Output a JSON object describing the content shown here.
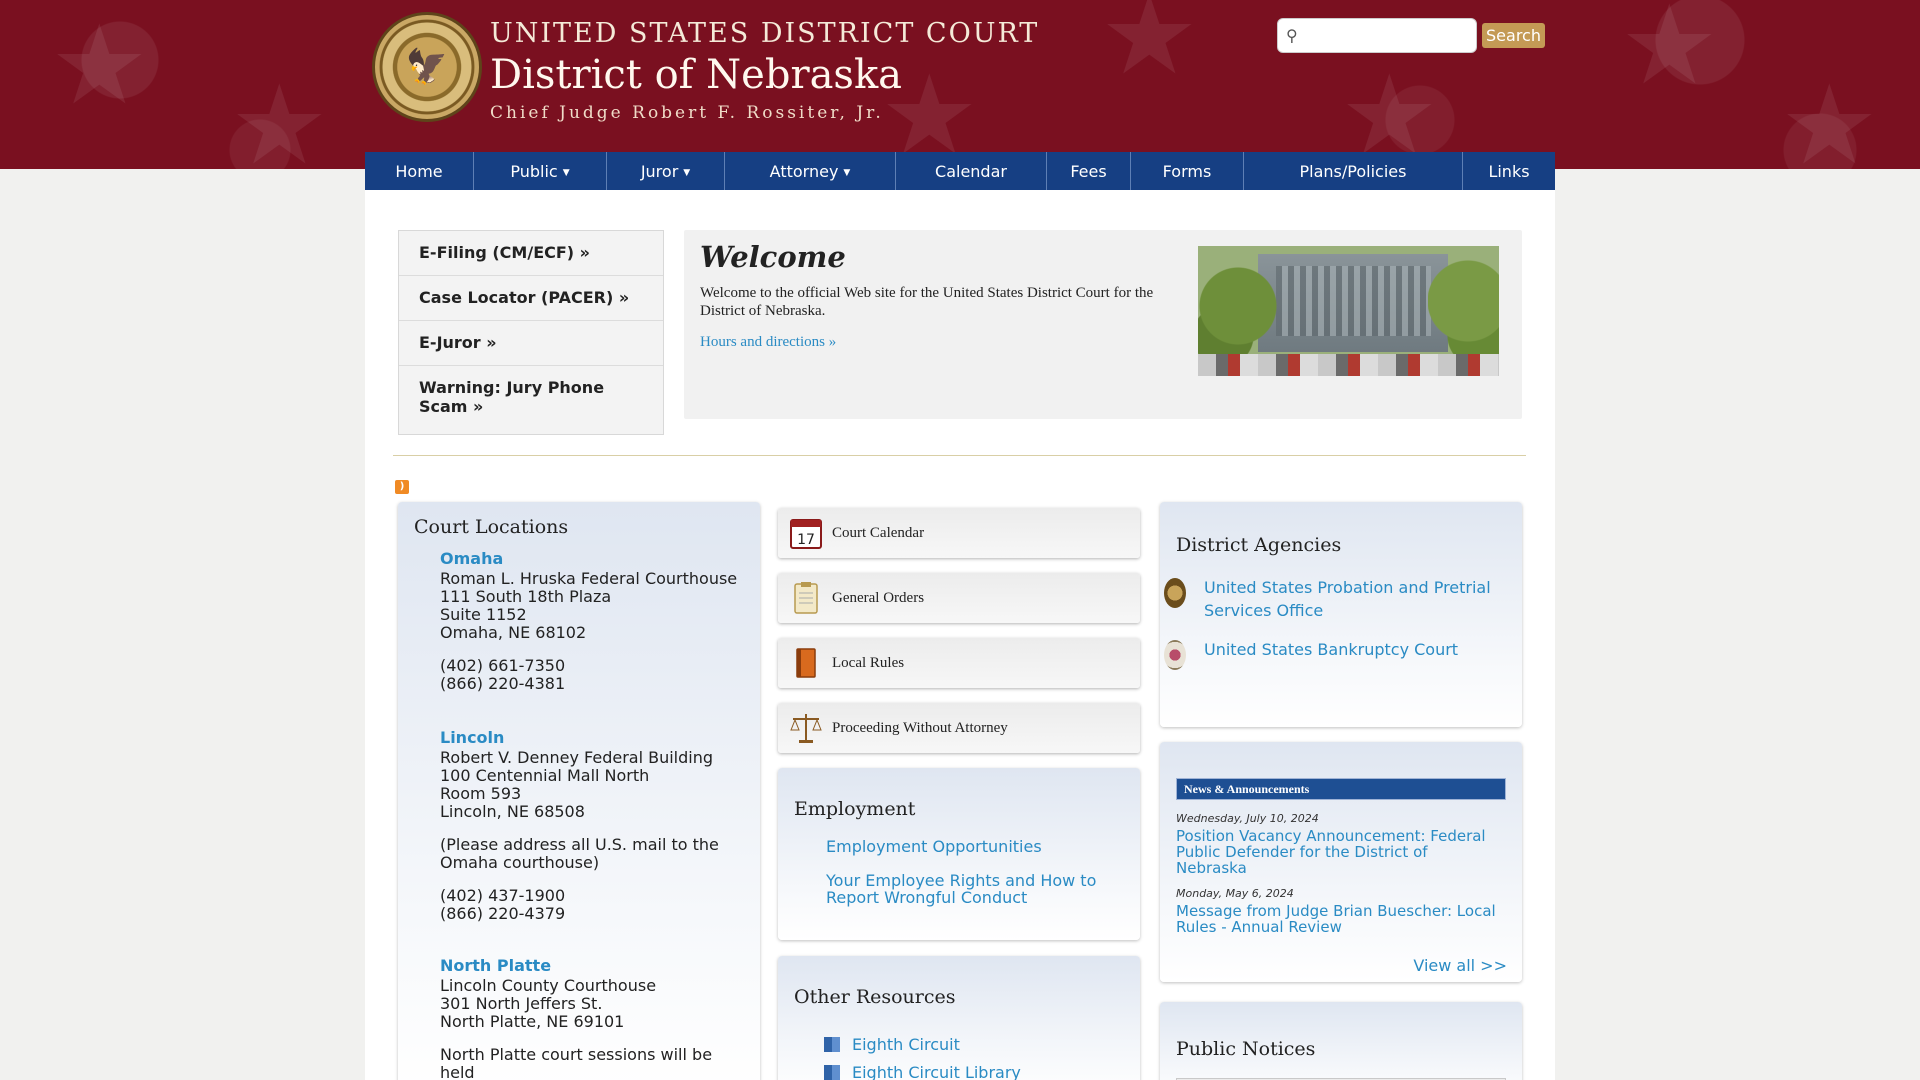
{
  "header": {
    "court_line1": "UNITED STATES DISTRICT COURT",
    "court_line2": "District of Nebraska",
    "court_line3": "Chief Judge Robert F. Rossiter, Jr.",
    "search_button": "Search",
    "search_placeholder": ""
  },
  "nav": {
    "items": [
      {
        "label": "Home"
      },
      {
        "label": "Public"
      },
      {
        "label": "Juror"
      },
      {
        "label": "Attorney"
      },
      {
        "label": "Calendar"
      },
      {
        "label": "Fees"
      },
      {
        "label": "Forms"
      },
      {
        "label": "Plans/Policies"
      },
      {
        "label": "Links"
      }
    ]
  },
  "quick_links": [
    "E-Filing (CM/ECF) »",
    "Case Locator (PACER) »",
    "E-Juror »",
    "Warning: Jury Phone Scam »"
  ],
  "welcome": {
    "title": "Welcome",
    "text": "Welcome to the official Web site for the United States District Court for the District of Nebraska.",
    "link": "Hours and directions »"
  },
  "locations": {
    "title": "Court Locations",
    "omaha": {
      "name": "Omaha",
      "line1": "Roman L. Hruska Federal Courthouse",
      "line2": "111 South 18th Plaza",
      "line3": "Suite 1152",
      "line4": "Omaha, NE  68102",
      "phone1": "(402) 661-7350",
      "phone2": "(866) 220-4381"
    },
    "lincoln": {
      "name": "Lincoln",
      "line1": "Robert V. Denney Federal Building",
      "line2": "100 Centennial Mall North",
      "line3": "Room 593",
      "line4": "Lincoln, NE  68508",
      "note": "(Please address all U.S. mail to the Omaha courthouse)",
      "phone1": "(402) 437-1900",
      "phone2": "(866) 220-4379"
    },
    "north_platte": {
      "name": "North Platte",
      "line1": "Lincoln County Courthouse",
      "line2": "301 North Jeffers St.",
      "line3": "North Platte, NE 69101",
      "note": "North Platte court sessions will be held"
    }
  },
  "resource_buttons": [
    {
      "label": "Court Calendar",
      "icon": "calendar-icon",
      "day": "17"
    },
    {
      "label": "General Orders",
      "icon": "clipboard-icon"
    },
    {
      "label": "Local Rules",
      "icon": "book-icon"
    },
    {
      "label": "Proceeding Without Attorney",
      "icon": "scales-icon"
    }
  ],
  "employment": {
    "title": "Employment",
    "link1": "Employment Opportunities",
    "link2": "Your Employee Rights and How to Report Wrongful Conduct"
  },
  "other_resources": {
    "title": "Other Resources",
    "link1": "Eighth Circuit",
    "link2": "Eighth Circuit Library"
  },
  "agencies": {
    "title": "District Agencies",
    "item1": "United States Probation and Pretrial Services Office",
    "item2": "United States Bankruptcy Court"
  },
  "news": {
    "bar": "News & Announcements",
    "date1": "Wednesday, July 10, 2024",
    "link1": "Position Vacancy Announcement: Federal Public Defender for the District of Nebraska",
    "date2": "Monday, May 6, 2024",
    "link2": "Message from Judge Brian Buescher: Local Rules - Annual Review",
    "view_all": "View all >>"
  },
  "notices": {
    "title": "Public Notices"
  },
  "colors": {
    "header_red": "#7a1020",
    "nav_blue": "#163f83",
    "link_blue": "#2a8bc4",
    "search_gold": "#c49a55"
  }
}
